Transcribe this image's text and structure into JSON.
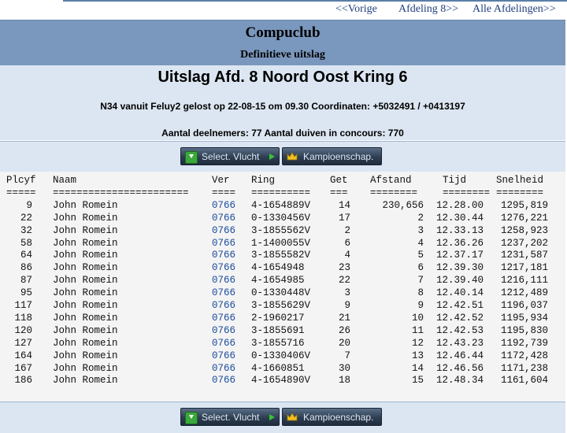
{
  "nav": {
    "prev": "<<Vorige",
    "section": "Afdeling 8>>",
    "all": "Alle Afdelingen>>"
  },
  "header": {
    "club": "Compuclub",
    "status": "Definitieve uitslag"
  },
  "info": {
    "title": "Uitslag Afd. 8 Noord Oost Kring 6",
    "release": "N34 vanuit Feluy2 gelost op 22-08-15 om 09.30 Coordinaten: +5032491 / +0413197",
    "participants": "Aantal deelnemers: 77 Aantal duiven in concours: 770"
  },
  "buttons": {
    "select_flight": "Select. Vlucht",
    "championship": "Kampioenschap."
  },
  "table": {
    "headers": [
      "Plcyf",
      "Naam",
      "Ver",
      "Ring",
      "Get",
      "Afstand",
      "Tijd",
      "Snelheid"
    ],
    "underlines": [
      "=====",
      "=======================",
      "====",
      "==========",
      "===",
      "========",
      "========",
      "========"
    ],
    "rows": [
      [
        "9",
        "John Romein",
        "0766",
        "4-1654889V",
        "14",
        "230,656",
        "12.28.00",
        "1295,819"
      ],
      [
        "22",
        "John Romein",
        "0766",
        "0-1330456V",
        "17",
        "2",
        "12.30.44",
        "1276,221"
      ],
      [
        "32",
        "John Romein",
        "0766",
        "3-1855562V",
        "2",
        "3",
        "12.33.13",
        "1258,923"
      ],
      [
        "58",
        "John Romein",
        "0766",
        "1-1400055V",
        "6",
        "4",
        "12.36.26",
        "1237,202"
      ],
      [
        "64",
        "John Romein",
        "0766",
        "3-1855582V",
        "4",
        "5",
        "12.37.17",
        "1231,587"
      ],
      [
        "86",
        "John Romein",
        "0766",
        "4-1654948",
        "23",
        "6",
        "12.39.30",
        "1217,181"
      ],
      [
        "87",
        "John Romein",
        "0766",
        "4-1654985",
        "22",
        "7",
        "12.39.40",
        "1216,111"
      ],
      [
        "95",
        "John Romein",
        "0766",
        "0-1330448V",
        "3",
        "8",
        "12.40.14",
        "1212,489"
      ],
      [
        "117",
        "John Romein",
        "0766",
        "3-1855629V",
        "9",
        "9",
        "12.42.51",
        "1196,037"
      ],
      [
        "118",
        "John Romein",
        "0766",
        "2-1960217",
        "21",
        "10",
        "12.42.52",
        "1195,934"
      ],
      [
        "120",
        "John Romein",
        "0766",
        "3-1855691",
        "26",
        "11",
        "12.42.53",
        "1195,830"
      ],
      [
        "127",
        "John Romein",
        "0766",
        "3-1855716",
        "20",
        "12",
        "12.43.23",
        "1192,739"
      ],
      [
        "164",
        "John Romein",
        "0766",
        "0-1330406V",
        "7",
        "13",
        "12.46.44",
        "1172,428"
      ],
      [
        "167",
        "John Romein",
        "0766",
        "4-1660851",
        "30",
        "14",
        "12.46.56",
        "1171,238"
      ],
      [
        "186",
        "John Romein",
        "0766",
        "4-1654890V",
        "18",
        "15",
        "12.48.34",
        "1161,604"
      ]
    ]
  },
  "colors": {
    "band": "#7a97bd",
    "panel": "#dce6f2",
    "link": "#1a4a9a"
  },
  "icons": {
    "download": "download-icon",
    "arrow": "arrow-right-icon",
    "crown": "crown-icon"
  }
}
